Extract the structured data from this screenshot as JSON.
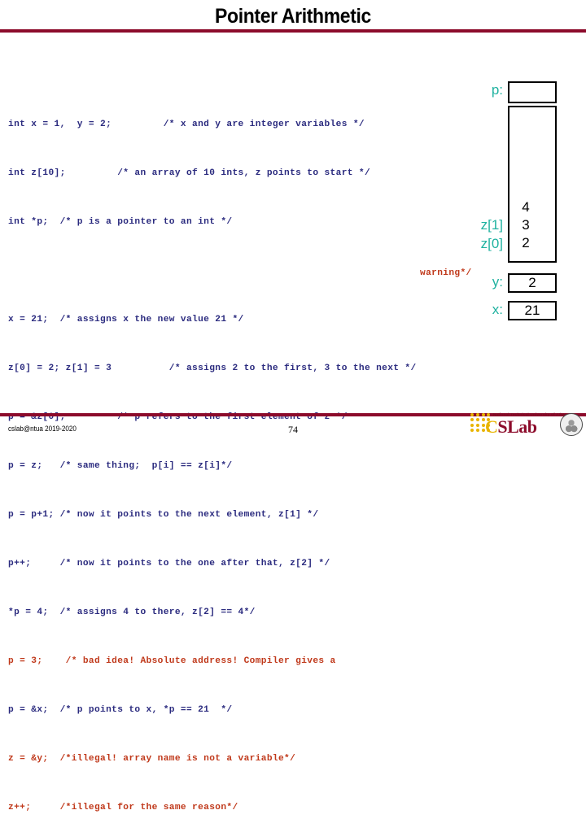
{
  "slide": {
    "title": "Pointer Arithmetic",
    "accent_color": "#8C0B2B",
    "code_color": "#2B2B7F",
    "error_color": "#C0391B",
    "label_color": "#20B2A0"
  },
  "code": {
    "block_1": [
      "int x = 1,  y = 2;         /* x and y are integer variables */",
      "int z[10];         /* an array of 10 ints, z points to start */",
      "int *p;  /* p is a pointer to an int */"
    ],
    "block_2": [
      "x = 21;  /* assigns x the new value 21 */",
      "z[0] = 2; z[1] = 3          /* assigns 2 to the first, 3 to the next */",
      "p = &z[0];         /* p refers to the first element of z */",
      "p = z;   /* same thing;  p[i] == z[i]*/",
      "p = p+1; /* now it points to the next element, z[1] */",
      "p++;     /* now it points to the one after that, z[2] */",
      "*p = 4;  /* assigns 4 to there, z[2] == 4*/"
    ],
    "line_bad_address": "p = 3;    /* bad idea! Absolute address! Compiler gives a",
    "warning_fragment": "warning*/",
    "block_3": [
      "p = &x;  /* p points to x, *p == 21  */"
    ],
    "block_3_bad": [
      "z = &y;  /*illegal! array name is not a variable*/",
      "z++;     /*illegal for the same reason*/"
    ]
  },
  "diagram": {
    "pointer": {
      "label": "p:",
      "value": ""
    },
    "array": {
      "label_z1": "z[1]",
      "label_z0": "z[0]",
      "cells": [
        {
          "value": "4"
        },
        {
          "value": "3"
        },
        {
          "value": "2"
        }
      ]
    },
    "var_y": {
      "label": "y:",
      "value": "2"
    },
    "var_x": {
      "label": "x:",
      "value": "21"
    }
  },
  "footer": {
    "credit": "cslab@ntua 2019-2020",
    "page_number": "74",
    "logo": {
      "university": "National Technical University of Athens",
      "wordmark_c": "C",
      "wordmark_rest": "SLab",
      "dots_icon": "dot-grid-icon",
      "seal_icon": "university-seal-icon"
    }
  }
}
